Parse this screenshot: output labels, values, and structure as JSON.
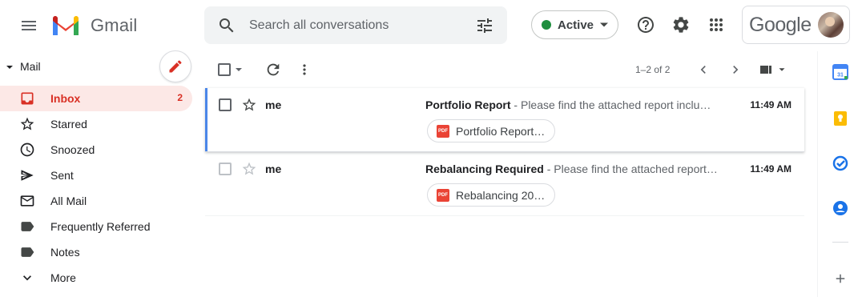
{
  "app": {
    "name": "Gmail",
    "brand_color": "#ea4335"
  },
  "header": {
    "search_placeholder": "Search all conversations",
    "status_label": "Active",
    "status_color": "#1e8e3e",
    "account_brand": "Google",
    "icons": [
      "menu-icon",
      "search-icon",
      "tune-icon",
      "chevron-down-icon",
      "help-icon",
      "gear-icon",
      "apps-icon",
      "avatar"
    ]
  },
  "sidebar": {
    "section_title": "Mail",
    "items": [
      {
        "label": "Inbox",
        "count": "2",
        "icon": "inbox-icon",
        "active": true
      },
      {
        "label": "Starred",
        "count": "",
        "icon": "star-icon",
        "active": false
      },
      {
        "label": "Snoozed",
        "count": "",
        "icon": "clock-icon",
        "active": false
      },
      {
        "label": "Sent",
        "count": "",
        "icon": "send-icon",
        "active": false
      },
      {
        "label": "All Mail",
        "count": "",
        "icon": "mail-icon",
        "active": false
      },
      {
        "label": "Frequently Referred",
        "count": "",
        "icon": "label-icon",
        "active": false
      },
      {
        "label": "Notes",
        "count": "",
        "icon": "label-icon",
        "active": false
      },
      {
        "label": "More",
        "count": "",
        "icon": "chevron-down-icon",
        "active": false
      }
    ]
  },
  "toolbar": {
    "pagination": "1–2 of 2"
  },
  "messages": [
    {
      "sender": "me",
      "subject": "Portfolio Report",
      "snippet": " - Please find the attached report inclu…",
      "time": "11:49 AM",
      "attachment": "Portfolio Report…",
      "attachment_type": "PDF"
    },
    {
      "sender": "me",
      "subject": "Rebalancing Required",
      "snippet": " - Please find the attached report…",
      "time": "11:49 AM",
      "attachment": "Rebalancing 20…",
      "attachment_type": "PDF"
    }
  ],
  "side_panel": {
    "calendar_day": "31",
    "icons": [
      "calendar-icon",
      "keep-icon",
      "tasks-icon",
      "contacts-icon",
      "plus-icon"
    ]
  }
}
